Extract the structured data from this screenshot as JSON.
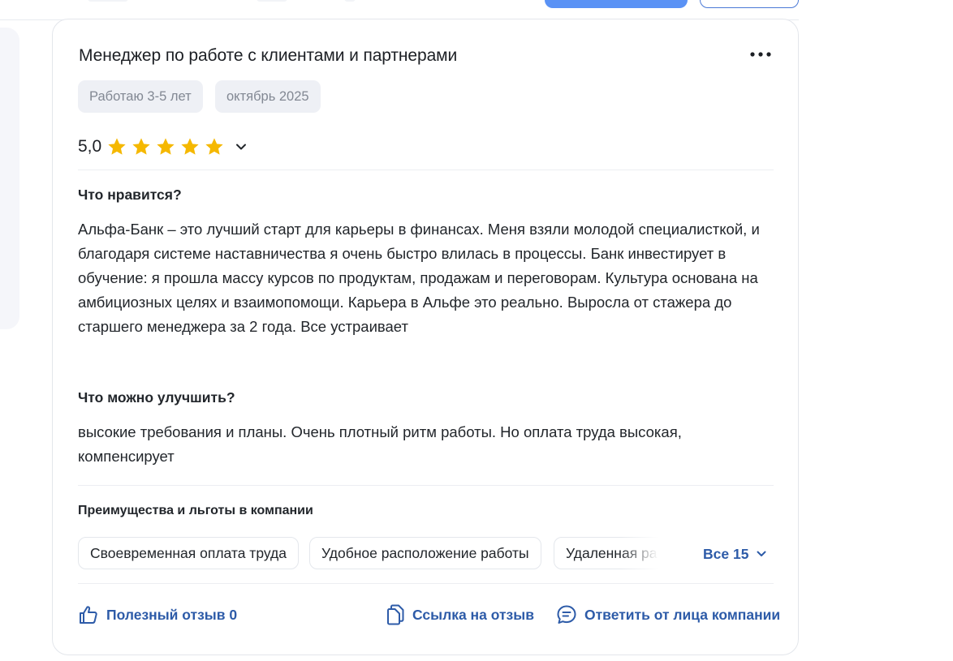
{
  "review": {
    "title": "Менеджер по работе с клиентами и партнерами",
    "tags": [
      "Работаю 3-5 лет",
      "октябрь 2025"
    ],
    "rating_value": "5,0",
    "rating": 5,
    "stars_max": 5,
    "likes_section_title": "Что нравится?",
    "likes_text": "Альфа-Банк – это лучший старт для карьеры в финансах. Меня взяли молодой специалисткой, и благодаря системе наставничества я очень быстро влилась в процессы. Банк инвестирует в обучение: я прошла массу курсов по продуктам, продажам и переговорам. Культура основана на амбициозных целях и взаимопомощи. Карьера в Альфе это реально. Выросла от стажера до старшего менеджера за 2 года. Все устраивает",
    "improve_section_title": "Что можно улучшить?",
    "improve_text": "высокие требования и планы. Очень плотный ритм работы. Но оплата труда высокая, компенсирует",
    "benefits_title": "Преимущества и льготы в компании",
    "benefits": [
      "Своевременная оплата труда",
      "Удобное расположение работы",
      "Удаленная работа"
    ],
    "benefits_all_label": "Все 15",
    "actions": {
      "helpful": "Полезный отзыв 0",
      "link": "Ссылка на отзыв",
      "reply": "Ответить от лица компании"
    }
  },
  "colors": {
    "accent": "#2d5ba8",
    "star": "#f5b800",
    "tag_bg": "#eef0f5",
    "primary_button": "#5a92f5"
  },
  "icons": {
    "more": "more-dots-icon",
    "star": "star-icon",
    "chevron": "chevron-down-icon",
    "helpful": "thumbs-up-icon",
    "link": "copy-icon",
    "reply": "chat-icon"
  }
}
